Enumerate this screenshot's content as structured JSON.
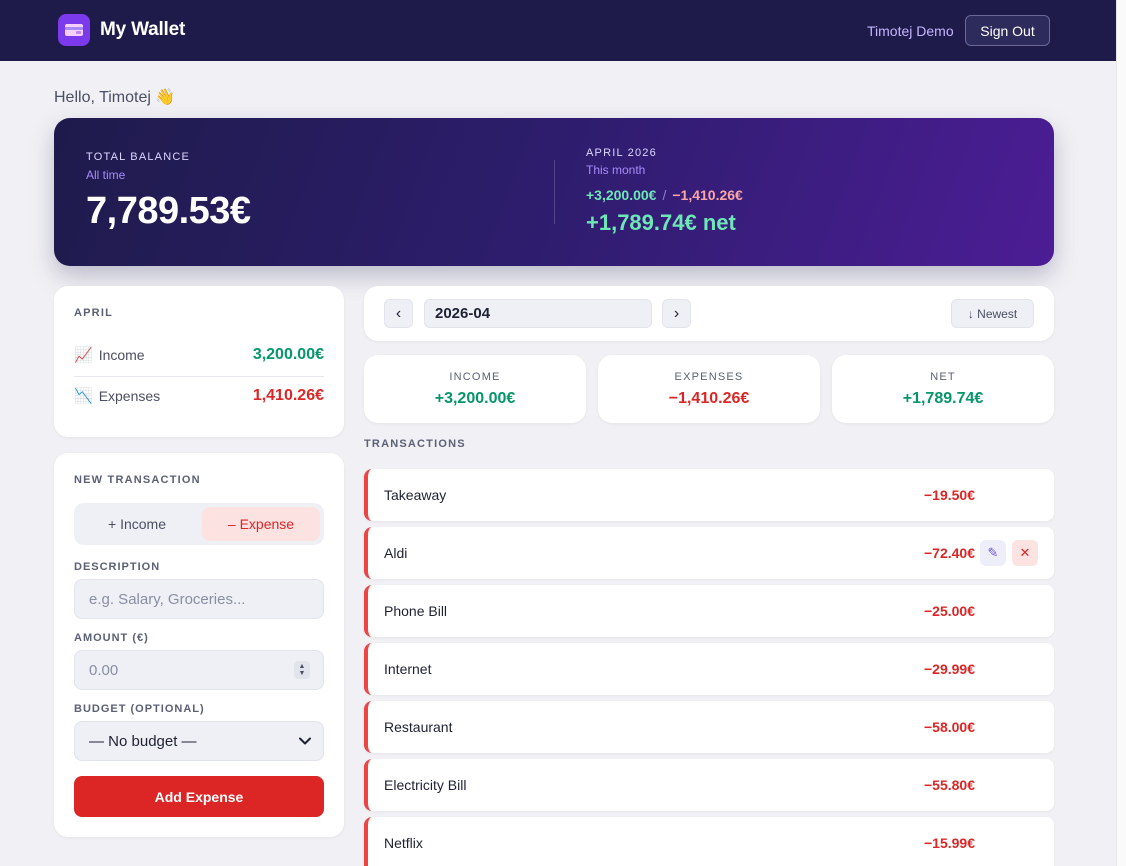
{
  "header": {
    "app_title": "My Wallet",
    "user_name": "Timotej Demo",
    "signout_label": "Sign Out"
  },
  "greeting": "Hello, Timotej 👋",
  "hero": {
    "total_label": "TOTAL BALANCE",
    "total_sub": "All time",
    "total_value": "7,789.53€",
    "month_label": "APRIL 2026",
    "month_sub": "This month",
    "month_income": "+3,200.00€",
    "month_separator": "/",
    "month_expense": "−1,410.26€",
    "month_net": "+1,789.74€ net"
  },
  "summary": {
    "title": "APRIL",
    "income_emoji": "📈",
    "income_label": "Income",
    "income_value": "3,200.00€",
    "expense_emoji": "📉",
    "expense_label": "Expenses",
    "expense_value": "1,410.26€"
  },
  "new_transaction": {
    "title": "NEW TRANSACTION",
    "toggle_income": "+ Income",
    "toggle_expense": "– Expense",
    "description_label": "DESCRIPTION",
    "description_placeholder": "e.g. Salary, Groceries...",
    "amount_label": "AMOUNT (€)",
    "amount_placeholder": "0.00",
    "budget_label": "BUDGET (OPTIONAL)",
    "budget_value": "— No budget —",
    "submit_label": "Add Expense"
  },
  "month_nav": {
    "prev_label": "‹",
    "next_label": "›",
    "month_value": "2026-04",
    "sort_label": "↓ Newest"
  },
  "stats": [
    {
      "label": "INCOME",
      "value": "+3,200.00€"
    },
    {
      "label": "EXPENSES",
      "value": "−1,410.26€"
    },
    {
      "label": "NET",
      "value": "+1,789.74€"
    }
  ],
  "transactions_title": "TRANSACTIONS",
  "transactions": [
    {
      "description": "Takeaway",
      "amount": "−19.50€"
    },
    {
      "description": "Aldi",
      "amount": "−72.40€"
    },
    {
      "description": "Phone Bill",
      "amount": "−25.00€"
    },
    {
      "description": "Internet",
      "amount": "−29.99€"
    },
    {
      "description": "Restaurant",
      "amount": "−58.00€"
    },
    {
      "description": "Electricity Bill",
      "amount": "−55.80€"
    },
    {
      "description": "Netflix",
      "amount": "−15.99€"
    }
  ],
  "icons": {
    "logo": "wallet-icon",
    "edit": "pencil-icon",
    "delete": "close-icon",
    "select": "chevron-down-icon",
    "stepper": "stepper-icon"
  },
  "colors": {
    "header_bg": "#1e1b4b",
    "accent": "#7c3aed",
    "income": "#059669",
    "expense": "#dc2626"
  }
}
